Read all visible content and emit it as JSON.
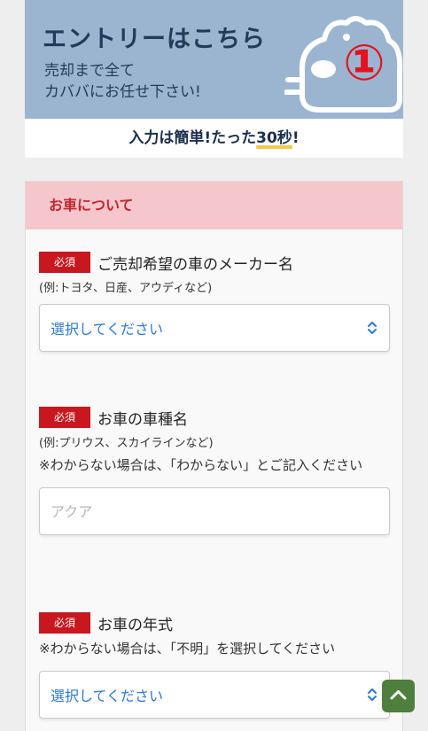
{
  "banner": {
    "title": "エントリーはこちら",
    "subtitle_line1": "売却まで全て",
    "subtitle_line2": "カババにお任せ下さい!",
    "step_number": "①"
  },
  "subbanner": {
    "text_before": "入力は簡単!たった",
    "highlight": "30秒",
    "text_after": "!"
  },
  "section": {
    "title": "お車について",
    "required_label": "必須"
  },
  "fields": {
    "maker": {
      "label": "ご売却希望の車のメーカー名",
      "hint": "(例:トヨタ、日産、アウディなど)",
      "value": "選択してください"
    },
    "model": {
      "label": "お車の車種名",
      "hint": "(例:プリウス、スカイラインなど)",
      "note": "※わからない場合は、「わからない」とご記入ください",
      "placeholder": "アクア"
    },
    "year": {
      "label": "お車の年式",
      "note": "※わからない場合は、「不明」を選択してください",
      "value": "選択してください"
    }
  },
  "colors": {
    "accent_red": "#c8171e",
    "header_pink": "#f5c6cb",
    "banner_blue": "#9bb5d1",
    "select_blue": "#2c78d4",
    "scroll_green": "#4e7f3c"
  },
  "icons": {
    "select": "chevron-up-down-icon",
    "scroll": "chevron-up-icon",
    "banner": "hippo-car-icon"
  }
}
